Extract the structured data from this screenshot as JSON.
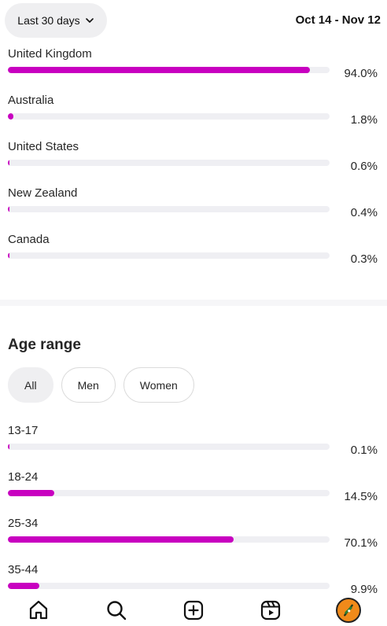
{
  "header": {
    "period_label": "Last 30 days",
    "date_range": "Oct 14 - Nov 12"
  },
  "countries": [
    {
      "label": "United Kingdom",
      "value": "94.0%",
      "percent": 94.0
    },
    {
      "label": "Australia",
      "value": "1.8%",
      "percent": 1.8
    },
    {
      "label": "United States",
      "value": "0.6%",
      "percent": 0.6
    },
    {
      "label": "New Zealand",
      "value": "0.4%",
      "percent": 0.4
    },
    {
      "label": "Canada",
      "value": "0.3%",
      "percent": 0.3
    }
  ],
  "age_section": {
    "title": "Age range",
    "filters": [
      "All",
      "Men",
      "Women"
    ],
    "selected_filter": "All",
    "ranges": [
      {
        "label": "13-17",
        "value": "0.1%",
        "percent": 0.1
      },
      {
        "label": "18-24",
        "value": "14.5%",
        "percent": 14.5
      },
      {
        "label": "25-34",
        "value": "70.1%",
        "percent": 70.1
      },
      {
        "label": "35-44",
        "value": "9.9%",
        "percent": 9.9
      }
    ]
  },
  "bottom_nav": [
    "home-icon",
    "search-icon",
    "create-icon",
    "reels-icon",
    "profile-avatar"
  ],
  "colors": {
    "bar_fill": "#c800c0",
    "bar_track": "#efeff3",
    "chip_active": "#efeff1"
  }
}
